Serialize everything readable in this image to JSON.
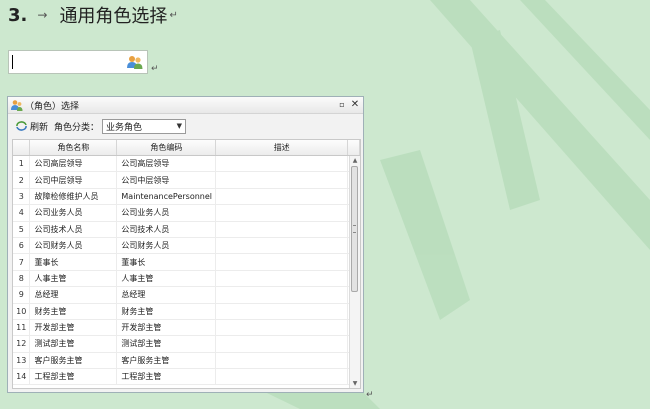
{
  "heading": {
    "number": "3.",
    "arrow": "→",
    "title": "通用角色选择",
    "para_mark": "↵"
  },
  "picker": {
    "value": "",
    "icon": "users-picker-icon",
    "para_mark": "↵"
  },
  "dialog": {
    "title": "（角色）选择",
    "toolbar": {
      "refresh_label": "刷新",
      "category_label": "角色分类：",
      "category_value": "业务角色"
    },
    "columns": [
      "角色名称",
      "角色编码",
      "描述"
    ],
    "rows": [
      {
        "n": "1",
        "name": "公司高层领导",
        "code": "公司高层领导",
        "desc": ""
      },
      {
        "n": "2",
        "name": "公司中层领导",
        "code": "公司中层领导",
        "desc": ""
      },
      {
        "n": "3",
        "name": "故障检修维护人员",
        "code": "MaintenancePersonnel",
        "desc": ""
      },
      {
        "n": "4",
        "name": "公司业务人员",
        "code": "公司业务人员",
        "desc": ""
      },
      {
        "n": "5",
        "name": "公司技术人员",
        "code": "公司技术人员",
        "desc": ""
      },
      {
        "n": "6",
        "name": "公司财务人员",
        "code": "公司财务人员",
        "desc": ""
      },
      {
        "n": "7",
        "name": "董事长",
        "code": "董事长",
        "desc": ""
      },
      {
        "n": "8",
        "name": "人事主管",
        "code": "人事主管",
        "desc": ""
      },
      {
        "n": "9",
        "name": "总经理",
        "code": "总经理",
        "desc": ""
      },
      {
        "n": "10",
        "name": "财务主管",
        "code": "财务主管",
        "desc": ""
      },
      {
        "n": "11",
        "name": "开发部主管",
        "code": "开发部主管",
        "desc": ""
      },
      {
        "n": "12",
        "name": "测试部主管",
        "code": "测试部主管",
        "desc": ""
      },
      {
        "n": "13",
        "name": "客户服务主管",
        "code": "客户服务主管",
        "desc": ""
      },
      {
        "n": "14",
        "name": "工程部主管",
        "code": "工程部主管",
        "desc": ""
      }
    ],
    "para_mark": "↵"
  }
}
